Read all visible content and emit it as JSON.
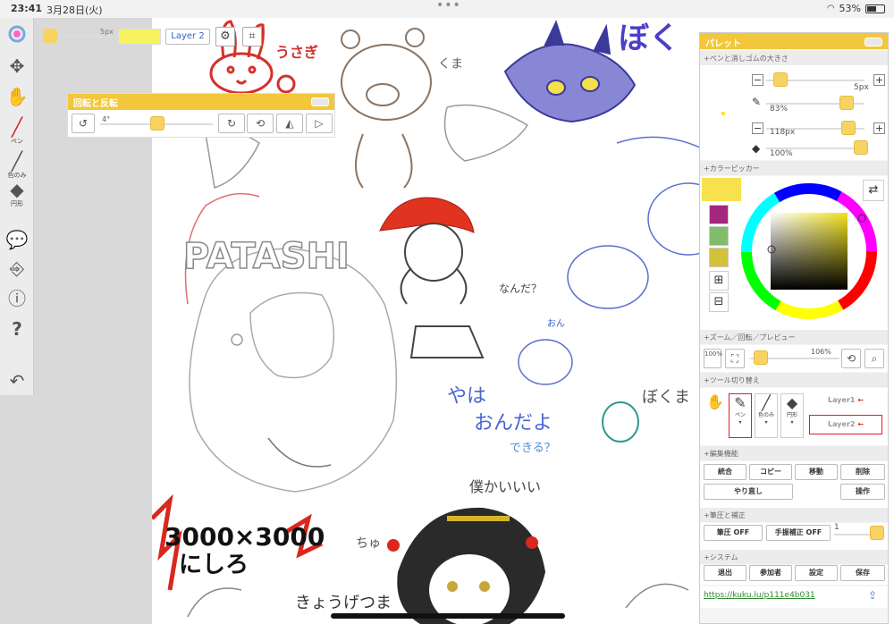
{
  "status": {
    "time": "23:41",
    "date": "3月28日(火)",
    "battery": "53%"
  },
  "leftbar": {
    "pen_label": "ペン",
    "fill_label": "色のみ",
    "shape_label": "円形"
  },
  "topstrip": {
    "size": "5px",
    "layer_button": "Layer 2"
  },
  "rotate_panel": {
    "title": "回転と反転",
    "angle": "4°"
  },
  "palette": {
    "title": "パレット",
    "sections": {
      "pen_size": "+ペンと消しゴムの大きさ",
      "color_picker": "+カラーピッカー",
      "zoom": "+ズーム／回転／プレビュー",
      "tool_switch": "+ツール切り替え",
      "edit": "+編集機能",
      "pressure": "+筆圧と補正",
      "system": "+システム"
    },
    "pen": {
      "size": "5px",
      "opacity": "83%"
    },
    "eraser": {
      "size": "118px",
      "opacity": "100%"
    },
    "colors": {
      "active": "#f7e24d",
      "swatch1": "#a4277f",
      "swatch2": "#7fbd6a",
      "swatch3": "#d1c23a"
    },
    "zoom": {
      "reset": "100%",
      "value": "106%"
    },
    "tools": {
      "pen": "ペン",
      "fill": "色のみ",
      "shape": "円形"
    },
    "layers": {
      "layer1": "Layer1",
      "layer2": "Layer2"
    },
    "edit": {
      "merge": "統合",
      "copy": "コピー",
      "move": "移動",
      "delete": "削除",
      "redo": "やり直し",
      "operate": "操作"
    },
    "pressure": {
      "pen_pressure": "筆圧 OFF",
      "stabilizer": "手振補正 OFF",
      "level": "1"
    },
    "system": {
      "exit": "退出",
      "members": "参加者",
      "settings": "設定",
      "save": "保存"
    },
    "url": "https://kuku.lu/p111e4b031"
  },
  "canvas_text": {
    "usagi": "うさぎ",
    "kuma": "くま",
    "boku": "ぼく",
    "patashi": "PATASHI",
    "nanda": "なんだ？",
    "yaha": "やは",
    "ondayo": "おんだよ",
    "osu": "おん",
    "dekiru": "できる？",
    "boku_ga": "僕かいいい",
    "size": "3000×3000",
    "nishiro": "にしろ",
    "chu": "ちゅ",
    "kyou": "きょうげつま",
    "bokuma": "ぼくま"
  }
}
